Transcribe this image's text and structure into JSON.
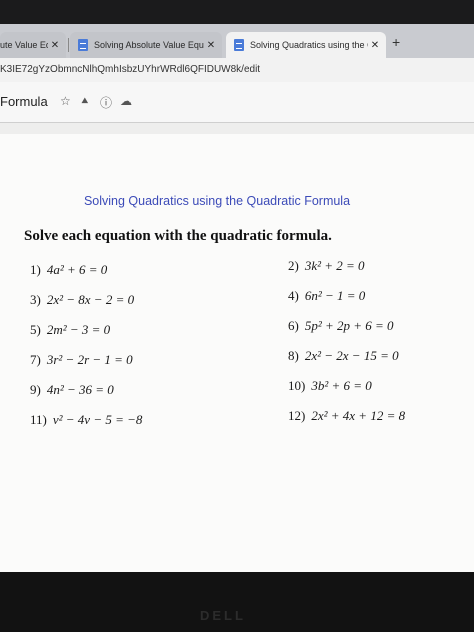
{
  "browser": {
    "tabs": [
      {
        "title": "ute Value Eq",
        "close": "✕"
      },
      {
        "title": "Solving Absolute Value Equation",
        "close": "✕"
      },
      {
        "title": "Solving Quadratics using the Qu",
        "close": "✕"
      }
    ],
    "new_tab": "+",
    "url": "K3IE72gYzObmncNlhQmhIsbzUYhrWRdl6QFIDUW8k/edit"
  },
  "doc_header": {
    "title": "Formula",
    "star_icon": "☆",
    "drive_icon": "⯅",
    "info_icon": "ⓘ",
    "cloud_icon": "☁"
  },
  "document": {
    "title": "Solving Quadratics using the Quadratic Formula",
    "instruction": "Solve each equation with the quadratic formula.",
    "problems": [
      {
        "num": "1)",
        "eq": "4a² + 6 = 0"
      },
      {
        "num": "2)",
        "eq": "3k² + 2 = 0"
      },
      {
        "num": "3)",
        "eq": "2x² − 8x − 2 = 0"
      },
      {
        "num": "4)",
        "eq": "6n² − 1 = 0"
      },
      {
        "num": "5)",
        "eq": "2m² − 3 = 0"
      },
      {
        "num": "6)",
        "eq": "5p² + 2p + 6 = 0"
      },
      {
        "num": "7)",
        "eq": "3r² − 2r − 1 = 0"
      },
      {
        "num": "8)",
        "eq": "2x² − 2x − 15 = 0"
      },
      {
        "num": "9)",
        "eq": "4n² − 36 = 0"
      },
      {
        "num": "10)",
        "eq": "3b² + 6 = 0"
      },
      {
        "num": "11)",
        "eq": "v² − 4v − 5 = −8"
      },
      {
        "num": "12)",
        "eq": "2x² + 4x + 12 = 8"
      }
    ]
  },
  "device": {
    "logo": "DELL"
  }
}
